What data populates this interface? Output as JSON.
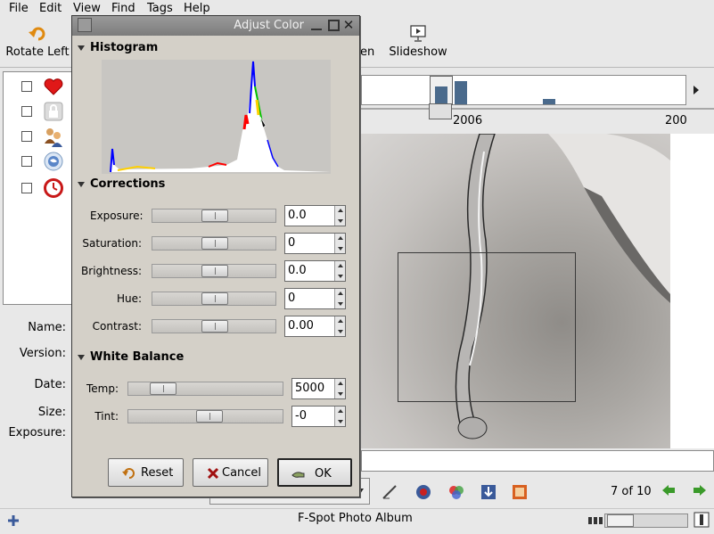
{
  "menu": [
    "File",
    "Edit",
    "View",
    "Find",
    "Tags",
    "Help"
  ],
  "toolbar": {
    "rotate_left": "Rotate Left",
    "fullscreen_fragment": "en",
    "slideshow": "Slideshow"
  },
  "tags": [
    {
      "icon": "heart-icon"
    },
    {
      "icon": "lock-icon"
    },
    {
      "icon": "people-icon"
    },
    {
      "icon": "globe-icon"
    },
    {
      "icon": "clock-icon"
    }
  ],
  "info": {
    "name": "Name:",
    "version": "Version:",
    "date": "Date:",
    "size": "Size:",
    "exposure": "Exposure:"
  },
  "timeline": {
    "year_label": "2006",
    "next_year_label": "200"
  },
  "dialog": {
    "title": "Adjust Color",
    "histogram_heading": "Histogram",
    "corrections_heading": "Corrections",
    "corrections": [
      {
        "label": "Exposure:",
        "value": "0.0",
        "level": 0.5
      },
      {
        "label": "Saturation:",
        "value": "0",
        "level": 0.5
      },
      {
        "label": "Brightness:",
        "value": "0.0",
        "level": 0.5
      },
      {
        "label": "Hue:",
        "value": "0",
        "level": 0.5
      },
      {
        "label": "Contrast:",
        "value": "0.00",
        "level": 0.5
      }
    ],
    "white_balance_heading": "White Balance",
    "white_balance": [
      {
        "label": "Temp:",
        "value": "5000",
        "level": 0.2
      },
      {
        "label": "Tint:",
        "value": "-0",
        "level": 0.5
      }
    ],
    "reset_label": "Reset",
    "cancel_label": "Cancel",
    "ok_label": "OK"
  },
  "pager": {
    "text": "7 of 10"
  },
  "status": {
    "title": "F-Spot Photo Album"
  },
  "colors": {
    "dialog_bg": "#d4d0c8",
    "titlebar": "#8a8a8a",
    "timeline_bar": "#4a6a8c"
  }
}
